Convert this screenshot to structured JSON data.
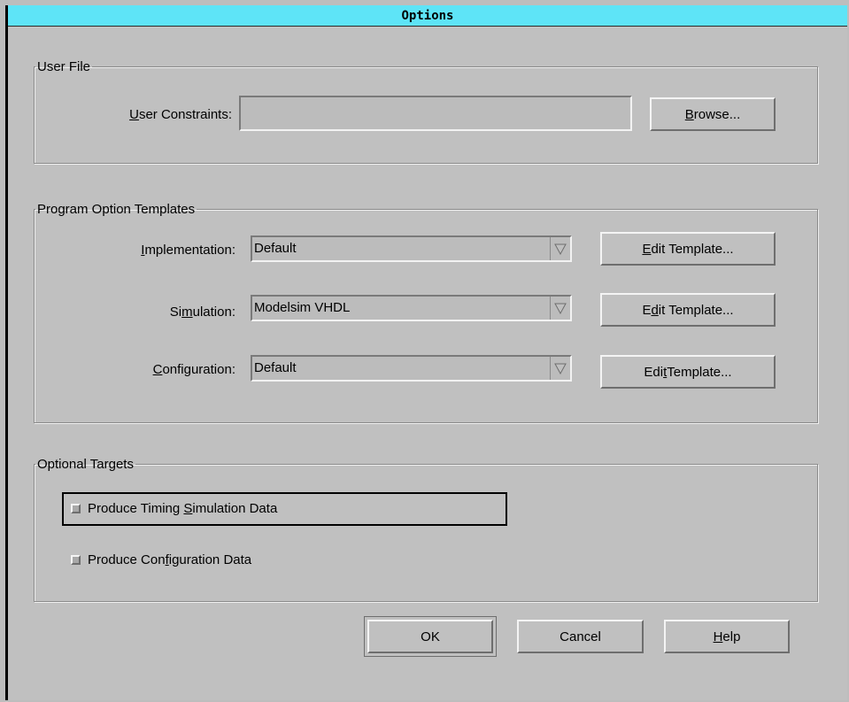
{
  "window": {
    "title": "Options"
  },
  "user_file": {
    "legend": "User File",
    "constraints_label_mnemonic": "U",
    "constraints_label_rest": "ser Constraints:",
    "constraints_value": "",
    "browse_mnemonic": "B",
    "browse_rest": "rowse..."
  },
  "templates": {
    "legend": "Program Option Templates",
    "rows": [
      {
        "label_pre": "",
        "label_mnemonic": "I",
        "label_post": "mplementation:",
        "value": "Default",
        "edit_pre": "",
        "edit_mnemonic": "E",
        "edit_post": "dit Template..."
      },
      {
        "label_pre": "Si",
        "label_mnemonic": "m",
        "label_post": "ulation:",
        "value": "Modelsim VHDL",
        "edit_pre": "E",
        "edit_mnemonic": "d",
        "edit_post": "it Template..."
      },
      {
        "label_pre": "",
        "label_mnemonic": "C",
        "label_post": "onfiguration:",
        "value": "Default",
        "edit_pre": "Edi",
        "edit_mnemonic": "t",
        "edit_post": " Template..."
      }
    ],
    "arrow_icon": "triangle-down"
  },
  "targets": {
    "legend": "Optional Targets",
    "timing": {
      "pre": "Produce Timing ",
      "mnemonic": "S",
      "post": "imulation Data",
      "checked": false
    },
    "config": {
      "pre": "Produce Con",
      "mnemonic": "f",
      "post": "iguration Data",
      "checked": false
    }
  },
  "buttons": {
    "ok": "OK",
    "cancel": "Cancel",
    "help_mnemonic": "H",
    "help_rest": "elp"
  },
  "colors": {
    "titlebar": "#5ee4f7",
    "background": "#c0c0c0"
  }
}
